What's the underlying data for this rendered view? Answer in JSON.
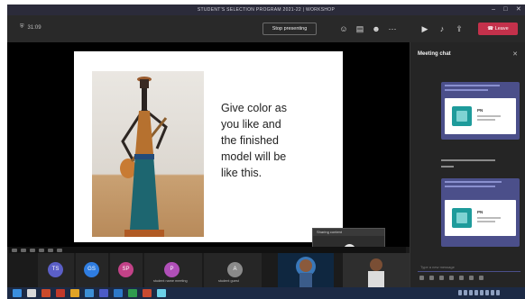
{
  "window": {
    "title": "STUDENT'S SELECTION PROGRAM 2021-22 | WORKSHOP",
    "controls": [
      "–",
      "□",
      "✕"
    ]
  },
  "toolbar": {
    "timer": "31:09",
    "stop_presenting_label": "Stop presenting",
    "leave_label": "Leave",
    "icons": [
      "participants-icon",
      "chat-icon",
      "reactions-icon",
      "more-icon",
      "camera-icon",
      "mic-icon",
      "share-icon"
    ]
  },
  "slide": {
    "lines": [
      "Give color as",
      "you like and",
      "the finished",
      "model will be",
      "like this."
    ]
  },
  "mini_video": {
    "title": "Sharing content"
  },
  "participants": [
    {
      "initials": "TS",
      "color": "#5b5fc7",
      "name": "..."
    },
    {
      "initials": "GS",
      "color": "#2f7de1",
      "name": "..."
    },
    {
      "initials": "SP",
      "color": "#c34288",
      "name": "..."
    },
    {
      "initials": "P",
      "color": "#b04fb8",
      "name": "student name meeting"
    },
    {
      "initials": "A",
      "color": "#8a8a8a",
      "name": "student guest"
    },
    {
      "initials": "",
      "color": "#1b3b63",
      "name": "user video"
    },
    {
      "initials": "",
      "color": "#3c3c3c",
      "name": "user video"
    }
  ],
  "chat": {
    "title": "Meeting chat",
    "file_name_1": "PN",
    "file_name_2": "PN",
    "compose_placeholder": "Type a new message"
  },
  "taskbar": {
    "time": "",
    "date": ""
  }
}
